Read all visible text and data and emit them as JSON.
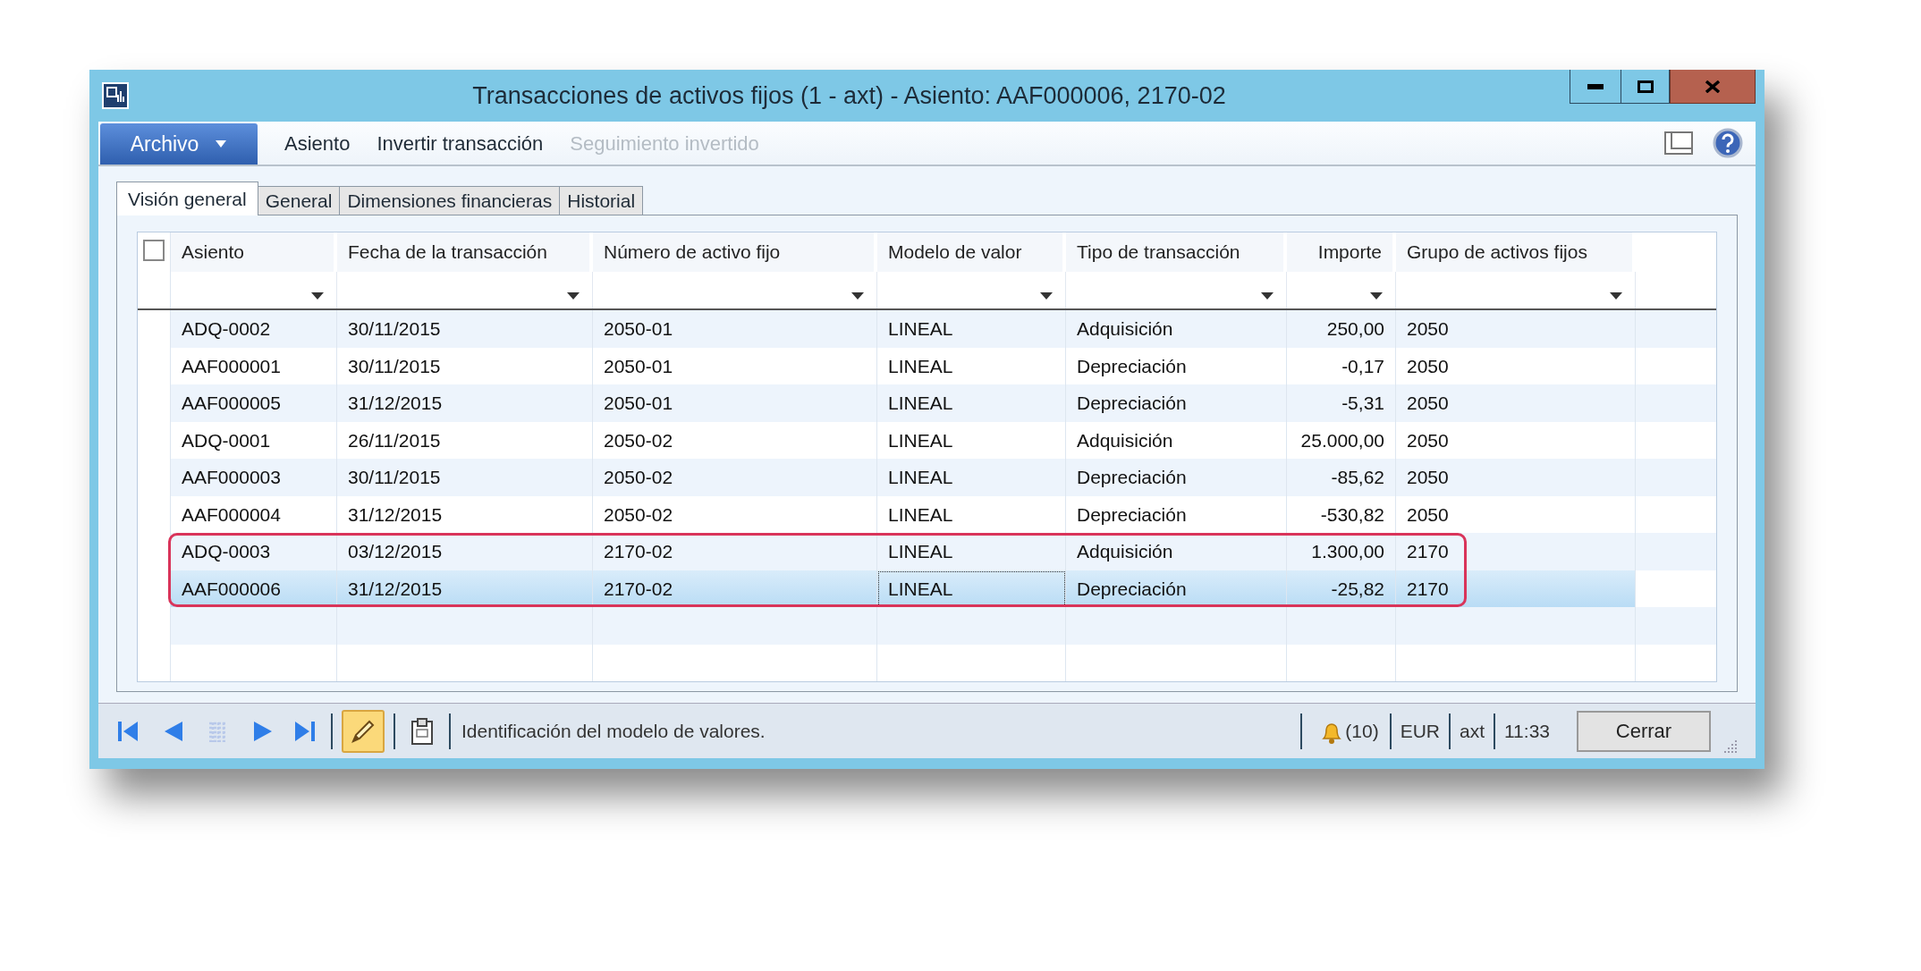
{
  "window": {
    "title": "Transacciones de activos fijos (1 - axt) - Asiento: AAF000006, 2170-02"
  },
  "menu": [
    {
      "label": "Archivo",
      "kind": "file"
    },
    {
      "label": "Asiento",
      "kind": "item",
      "disabled": false
    },
    {
      "label": "Invertir transacción",
      "kind": "item",
      "disabled": false
    },
    {
      "label": "Seguimiento invertido",
      "kind": "item",
      "disabled": true
    }
  ],
  "tabs": [
    {
      "label": "Visión general",
      "selected": true
    },
    {
      "label": "General",
      "selected": false
    },
    {
      "label": "Dimensiones financieras",
      "selected": false
    },
    {
      "label": "Historial",
      "selected": false
    }
  ],
  "table": {
    "select_all": {
      "checked": false
    },
    "columns": [
      {
        "label": "Asiento",
        "kind": "text"
      },
      {
        "label": "Fecha de la transacción",
        "kind": "text"
      },
      {
        "label": "Número de activo fijo",
        "kind": "text"
      },
      {
        "label": "Modelo de valor",
        "kind": "text"
      },
      {
        "label": "Tipo de transacción",
        "kind": "text"
      },
      {
        "label": "Importe",
        "kind": "amount"
      },
      {
        "label": "Grupo de activos fijos",
        "kind": "text"
      }
    ],
    "rows": [
      {
        "cells": [
          "ADQ-0002",
          "30/11/2015",
          "2050-01",
          "LINEAL",
          "Adquisición",
          "250,00",
          "2050"
        ],
        "selected": false,
        "highlighted": false
      },
      {
        "cells": [
          "AAF000001",
          "30/11/2015",
          "2050-01",
          "LINEAL",
          "Depreciación",
          "-0,17",
          "2050"
        ],
        "selected": false,
        "highlighted": false
      },
      {
        "cells": [
          "AAF000005",
          "31/12/2015",
          "2050-01",
          "LINEAL",
          "Depreciación",
          "-5,31",
          "2050"
        ],
        "selected": false,
        "highlighted": false
      },
      {
        "cells": [
          "ADQ-0001",
          "26/11/2015",
          "2050-02",
          "LINEAL",
          "Adquisición",
          "25.000,00",
          "2050"
        ],
        "selected": false,
        "highlighted": false
      },
      {
        "cells": [
          "AAF000003",
          "30/11/2015",
          "2050-02",
          "LINEAL",
          "Depreciación",
          "-85,62",
          "2050"
        ],
        "selected": false,
        "highlighted": false
      },
      {
        "cells": [
          "AAF000004",
          "31/12/2015",
          "2050-02",
          "LINEAL",
          "Depreciación",
          "-530,82",
          "2050"
        ],
        "selected": false,
        "highlighted": false
      },
      {
        "cells": [
          "ADQ-0003",
          "03/12/2015",
          "2170-02",
          "LINEAL",
          "Adquisición",
          "1.300,00",
          "2170"
        ],
        "selected": false,
        "highlighted": true
      },
      {
        "cells": [
          "AAF000006",
          "31/12/2015",
          "2170-02",
          "LINEAL",
          "Depreciación",
          "-25,82",
          "2170"
        ],
        "selected": true,
        "highlighted": true
      }
    ]
  },
  "status_bar": {
    "edit_mode": {
      "on": true
    },
    "message": "Identificación del modelo de valores.",
    "notifications": "(10)",
    "currency": "EUR",
    "company": "axt",
    "time": "11:33",
    "close_button": "Cerrar"
  }
}
